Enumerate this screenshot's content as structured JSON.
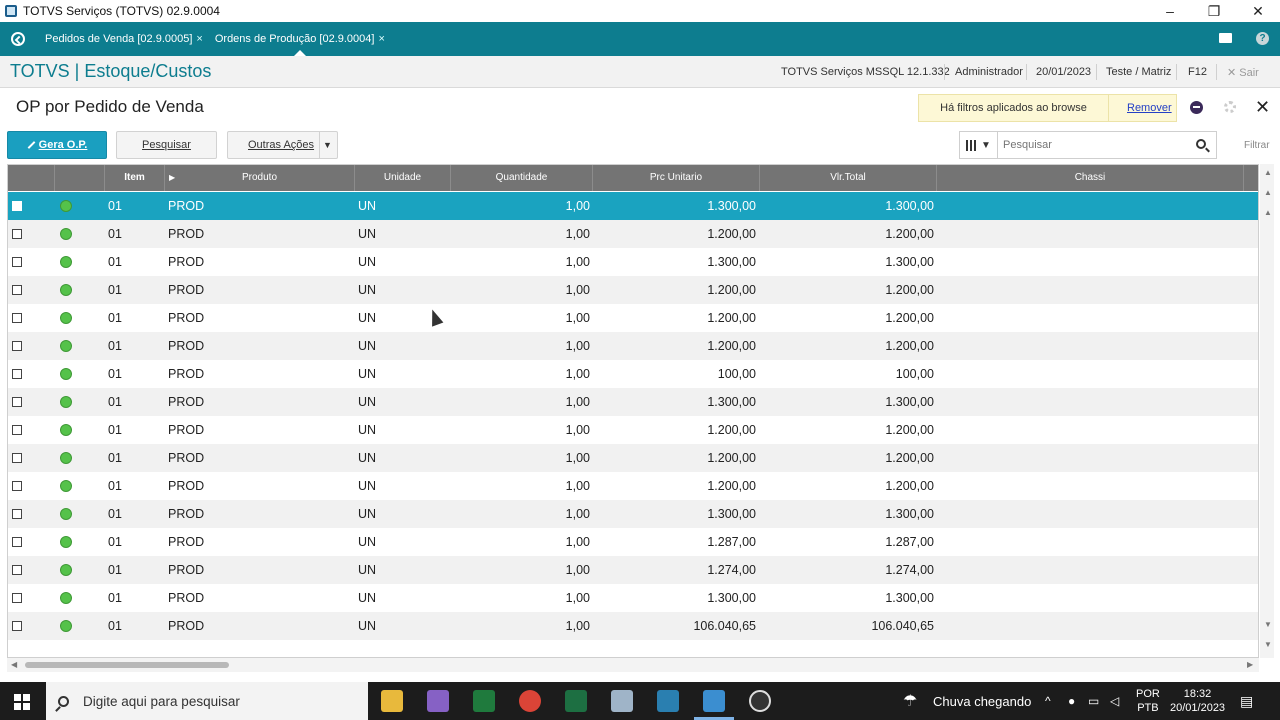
{
  "window": {
    "title": "TOTVS Serviços (TOTVS) 02.9.0004",
    "minimize": "–",
    "restore": "❐",
    "close": "✕"
  },
  "tabs": [
    {
      "label": "Pedidos de Venda [02.9.0005]",
      "close": "×"
    },
    {
      "label": "Ordens de Produção [02.9.0004]",
      "close": "×"
    }
  ],
  "tabs_right": {
    "help": "?"
  },
  "module": {
    "name": "TOTVS | Estoque/Custos",
    "environment": "TOTVS Serviços MSSQL 12.1.332",
    "user": "Administrador",
    "date": "20/01/2023",
    "branch": "Teste / Matriz",
    "shortcut": "F12",
    "exit": "✕  Sair"
  },
  "page": {
    "title": "OP por Pedido de Venda",
    "filter_message": "Há filtros aplicados ao browse",
    "filter_remove": "Remover"
  },
  "toolbar": {
    "generate": "Gera O.P.",
    "search": "Pesquisar",
    "other_actions": "Outras Ações",
    "search_placeholder": "Pesquisar",
    "filter": "Filtrar"
  },
  "grid": {
    "columns": [
      "Item",
      "Produto",
      "Unidade",
      "Quantidade",
      "Prc Unitario",
      "Vlr.Total",
      "Chassi"
    ],
    "rows": [
      {
        "item": "01",
        "produto": "PROD",
        "unidade": "UN",
        "quantidade": "1,00",
        "prc": "1.300,00",
        "total": "1.300,00",
        "selected": true
      },
      {
        "item": "01",
        "produto": "PROD",
        "unidade": "UN",
        "quantidade": "1,00",
        "prc": "1.200,00",
        "total": "1.200,00"
      },
      {
        "item": "01",
        "produto": "PROD",
        "unidade": "UN",
        "quantidade": "1,00",
        "prc": "1.300,00",
        "total": "1.300,00"
      },
      {
        "item": "01",
        "produto": "PROD",
        "unidade": "UN",
        "quantidade": "1,00",
        "prc": "1.200,00",
        "total": "1.200,00"
      },
      {
        "item": "01",
        "produto": "PROD",
        "unidade": "UN",
        "quantidade": "1,00",
        "prc": "1.200,00",
        "total": "1.200,00"
      },
      {
        "item": "01",
        "produto": "PROD",
        "unidade": "UN",
        "quantidade": "1,00",
        "prc": "1.200,00",
        "total": "1.200,00"
      },
      {
        "item": "01",
        "produto": "PROD",
        "unidade": "UN",
        "quantidade": "1,00",
        "prc": "100,00",
        "total": "100,00"
      },
      {
        "item": "01",
        "produto": "PROD",
        "unidade": "UN",
        "quantidade": "1,00",
        "prc": "1.300,00",
        "total": "1.300,00"
      },
      {
        "item": "01",
        "produto": "PROD",
        "unidade": "UN",
        "quantidade": "1,00",
        "prc": "1.200,00",
        "total": "1.200,00"
      },
      {
        "item": "01",
        "produto": "PROD",
        "unidade": "UN",
        "quantidade": "1,00",
        "prc": "1.200,00",
        "total": "1.200,00"
      },
      {
        "item": "01",
        "produto": "PROD",
        "unidade": "UN",
        "quantidade": "1,00",
        "prc": "1.200,00",
        "total": "1.200,00"
      },
      {
        "item": "01",
        "produto": "PROD",
        "unidade": "UN",
        "quantidade": "1,00",
        "prc": "1.300,00",
        "total": "1.300,00"
      },
      {
        "item": "01",
        "produto": "PROD",
        "unidade": "UN",
        "quantidade": "1,00",
        "prc": "1.287,00",
        "total": "1.287,00"
      },
      {
        "item": "01",
        "produto": "PROD",
        "unidade": "UN",
        "quantidade": "1,00",
        "prc": "1.274,00",
        "total": "1.274,00"
      },
      {
        "item": "01",
        "produto": "PROD",
        "unidade": "UN",
        "quantidade": "1,00",
        "prc": "1.300,00",
        "total": "1.300,00"
      },
      {
        "item": "01",
        "produto": "PROD",
        "unidade": "UN",
        "quantidade": "1,00",
        "prc": "106.040,65",
        "total": "106.040,65"
      }
    ]
  },
  "taskbar": {
    "search_placeholder": "Digite aqui para pesquisar",
    "weather": "Chuva chegando",
    "lang_top": "POR",
    "lang_bottom": "PTB",
    "time": "18:32",
    "date": "20/01/2023"
  },
  "colors": {
    "accent": "#0d7d8f",
    "selected_row": "#1aa3c0",
    "status_ok": "#55c24a"
  }
}
